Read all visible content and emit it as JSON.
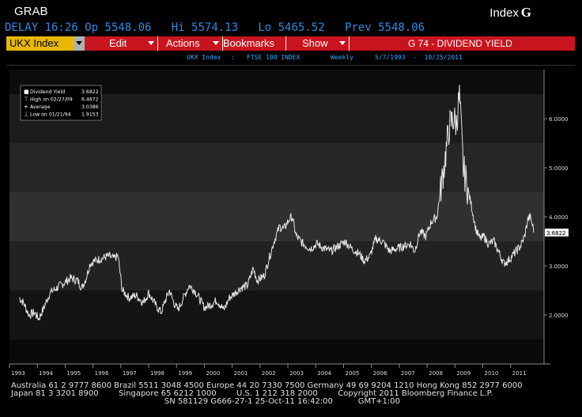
{
  "header": {
    "title": "GRAB",
    "index_label": "Index",
    "logo": "G",
    "quote": {
      "delay": "DELAY 16:26",
      "open": "Op 5548.06",
      "high": "Hi 5574.13",
      "low": "Lo 5465.52",
      "prev": "Prev 5548.06"
    }
  },
  "menubar": {
    "ticker": "UKX Index",
    "items": [
      "Edit",
      "Actions",
      "Bookmarks",
      "Show"
    ],
    "function": "G 74 - DIVIDEND YIELD"
  },
  "subheader": {
    "security": "UKX Index",
    "separator": ":",
    "name": "FTSE 100 INDEX",
    "period": "Weekly",
    "range": "5/7/1993  -  10/25/2011"
  },
  "legend": {
    "items": [
      {
        "label": "Dividend Yield",
        "value": "3.6822"
      },
      {
        "label": "High on 02/27/09",
        "value": "6.4672"
      },
      {
        "label": "Average",
        "value": "3.0386"
      },
      {
        "label": "Low on 01/21/94",
        "value": "1.9153"
      }
    ]
  },
  "chart_data": {
    "type": "line",
    "series": [
      {
        "name": "Dividend Yield",
        "points": [
          [
            1993.35,
            2.35
          ],
          [
            1993.5,
            2.25
          ],
          [
            1993.7,
            2.0
          ],
          [
            1993.9,
            2.05
          ],
          [
            1994.05,
            1.92
          ],
          [
            1994.2,
            2.1
          ],
          [
            1994.45,
            2.45
          ],
          [
            1994.7,
            2.55
          ],
          [
            1994.95,
            2.65
          ],
          [
            1995.2,
            2.75
          ],
          [
            1995.45,
            2.7
          ],
          [
            1995.6,
            2.55
          ],
          [
            1995.75,
            2.75
          ],
          [
            1995.9,
            3.05
          ],
          [
            1996.05,
            3.1
          ],
          [
            1996.3,
            3.15
          ],
          [
            1996.55,
            3.2
          ],
          [
            1996.75,
            3.15
          ],
          [
            1996.9,
            3.2
          ],
          [
            1997.05,
            2.5
          ],
          [
            1997.3,
            2.35
          ],
          [
            1997.55,
            2.4
          ],
          [
            1997.8,
            2.25
          ],
          [
            1998.0,
            2.45
          ],
          [
            1998.25,
            2.2
          ],
          [
            1998.45,
            2.05
          ],
          [
            1998.6,
            2.3
          ],
          [
            1998.75,
            2.5
          ],
          [
            1998.9,
            2.25
          ],
          [
            1999.05,
            2.1
          ],
          [
            1999.25,
            2.35
          ],
          [
            1999.45,
            2.6
          ],
          [
            1999.65,
            2.5
          ],
          [
            1999.85,
            2.3
          ],
          [
            2000.0,
            2.15
          ],
          [
            2000.2,
            2.2
          ],
          [
            2000.45,
            2.3
          ],
          [
            2000.7,
            2.1
          ],
          [
            2000.9,
            2.35
          ],
          [
            2001.1,
            2.45
          ],
          [
            2001.3,
            2.55
          ],
          [
            2001.55,
            2.6
          ],
          [
            2001.75,
            2.95
          ],
          [
            2001.9,
            2.7
          ],
          [
            2002.15,
            2.8
          ],
          [
            2002.3,
            3.1
          ],
          [
            2002.5,
            3.5
          ],
          [
            2002.7,
            3.8
          ],
          [
            2002.85,
            3.75
          ],
          [
            2003.05,
            3.95
          ],
          [
            2003.15,
            4.0
          ],
          [
            2003.3,
            3.6
          ],
          [
            2003.55,
            3.45
          ],
          [
            2003.8,
            3.35
          ],
          [
            2004.05,
            3.45
          ],
          [
            2004.3,
            3.35
          ],
          [
            2004.55,
            3.3
          ],
          [
            2004.8,
            3.4
          ],
          [
            2005.05,
            3.5
          ],
          [
            2005.3,
            3.35
          ],
          [
            2005.55,
            3.25
          ],
          [
            2005.75,
            3.1
          ],
          [
            2005.95,
            3.2
          ],
          [
            2006.15,
            3.55
          ],
          [
            2006.4,
            3.5
          ],
          [
            2006.65,
            3.3
          ],
          [
            2006.9,
            3.35
          ],
          [
            2007.15,
            3.4
          ],
          [
            2007.4,
            3.45
          ],
          [
            2007.55,
            3.3
          ],
          [
            2007.75,
            3.7
          ],
          [
            2007.95,
            3.6
          ],
          [
            2008.15,
            3.9
          ],
          [
            2008.35,
            4.0
          ],
          [
            2008.5,
            4.6
          ],
          [
            2008.65,
            5.2
          ],
          [
            2008.8,
            5.85
          ],
          [
            2008.95,
            6.0
          ],
          [
            2009.05,
            5.9
          ],
          [
            2009.16,
            6.47
          ],
          [
            2009.3,
            5.0
          ],
          [
            2009.45,
            4.6
          ],
          [
            2009.6,
            4.2
          ],
          [
            2009.75,
            3.75
          ],
          [
            2009.9,
            3.55
          ],
          [
            2010.05,
            3.6
          ],
          [
            2010.2,
            3.45
          ],
          [
            2010.4,
            3.5
          ],
          [
            2010.6,
            3.25
          ],
          [
            2010.75,
            3.05
          ],
          [
            2010.9,
            3.1
          ],
          [
            2011.05,
            3.2
          ],
          [
            2011.2,
            3.3
          ],
          [
            2011.35,
            3.4
          ],
          [
            2011.5,
            3.6
          ],
          [
            2011.62,
            3.95
          ],
          [
            2011.7,
            4.0
          ],
          [
            2011.82,
            3.75
          ],
          [
            2011.82,
            3.68
          ]
        ]
      }
    ],
    "x_ticks": [
      "1993",
      "1994",
      "1995",
      "1996",
      "1997",
      "1998",
      "1999",
      "2000",
      "2001",
      "2002",
      "2003",
      "2004",
      "2005",
      "2006",
      "2007",
      "2008",
      "2009",
      "2010",
      "2011"
    ],
    "y_ticks": [
      "2.0000",
      "3.0000",
      "4.0000",
      "5.0000",
      "6.0000"
    ],
    "ylim": [
      1.0,
      7.0
    ],
    "xlim": [
      1993.0,
      2012.2
    ],
    "last_value_label": "3.6822",
    "colors": {
      "line": "#e6e6e6",
      "bands": [
        "#0a0a0a",
        "#222222",
        "#343434"
      ]
    }
  },
  "footer": {
    "line1": "Australia 61 2 9777 8600 Brazil 5511 3048 4500 Europe 44 20 7330 7500 Germany 49 69 9204 1210 Hong Kong 852 2977 6000",
    "line2": "Japan 81 3 3201 8900        Singapore 65 6212 1000        U.S. 1 212 318 2000        Copyright 2011 Bloomberg Finance L.P.",
    "line3": "                                                             SN 581129 G666-27-1 25-Oct-11 16:42:00          GMT+1:00"
  }
}
